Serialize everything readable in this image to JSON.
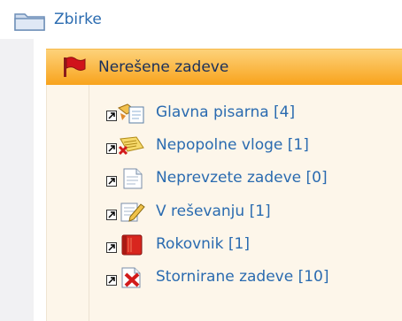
{
  "tree": {
    "root": {
      "label": "Zbirke",
      "icon": "folder-icon"
    },
    "selected": {
      "label": "Nerešene zadeve",
      "icon": "red-flag-icon"
    },
    "children": [
      {
        "label": "Glavna pisarna [4]",
        "icon": "new-documents-icon"
      },
      {
        "label": "Nepopolne vloge [1]",
        "icon": "incomplete-documents-icon"
      },
      {
        "label": "Neprevzete zadeve [0]",
        "icon": "document-icon"
      },
      {
        "label": "V reševanju [1]",
        "icon": "edit-document-icon"
      },
      {
        "label": "Rokovnik [1]",
        "icon": "planner-book-icon"
      },
      {
        "label": "Stornirane zadeve [10]",
        "icon": "cancelled-document-icon"
      }
    ]
  },
  "colors": {
    "link": "#2a6bb0",
    "selected_text": "#1a2f5a",
    "selected_bg_top": "#fdd27a",
    "selected_bg_bottom": "#f8a31c",
    "panel_bg": "#fdf6ea"
  }
}
